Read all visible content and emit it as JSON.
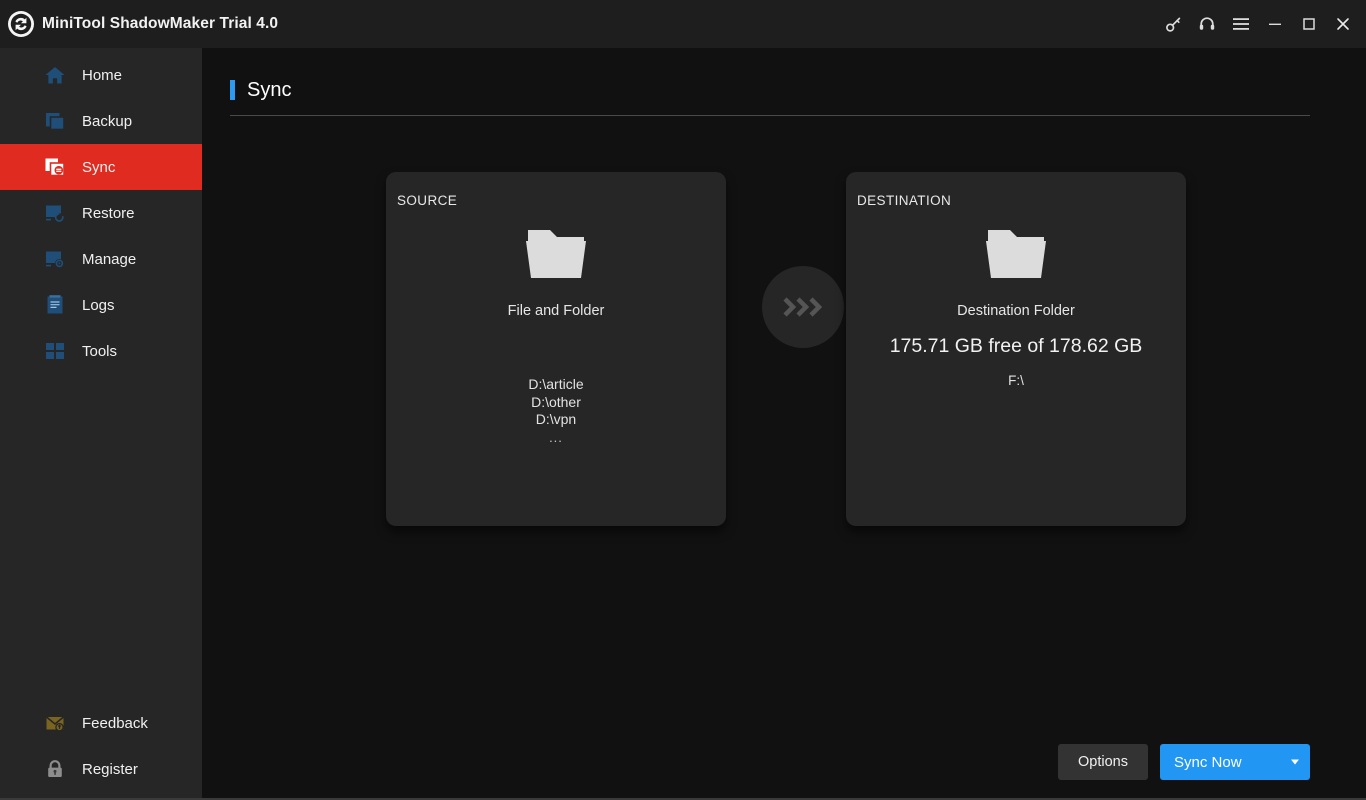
{
  "window": {
    "title": "MiniTool ShadowMaker Trial 4.0",
    "logo_icon": "sync-circle-logo-icon",
    "controls": [
      {
        "name": "key-icon",
        "label": "Key"
      },
      {
        "name": "headset-icon",
        "label": "Support"
      },
      {
        "name": "hamburger-icon",
        "label": "Menu"
      },
      {
        "name": "minimize-icon",
        "label": "Minimize"
      },
      {
        "name": "maximize-icon",
        "label": "Maximize"
      },
      {
        "name": "close-icon",
        "label": "Close"
      }
    ]
  },
  "sidebar": {
    "items": [
      {
        "label": "Home",
        "icon": "home-icon",
        "active": false
      },
      {
        "label": "Backup",
        "icon": "backup-icon",
        "active": false
      },
      {
        "label": "Sync",
        "icon": "sync-icon",
        "active": true
      },
      {
        "label": "Restore",
        "icon": "restore-icon",
        "active": false
      },
      {
        "label": "Manage",
        "icon": "manage-icon",
        "active": false
      },
      {
        "label": "Logs",
        "icon": "logs-icon",
        "active": false
      },
      {
        "label": "Tools",
        "icon": "tools-icon",
        "active": false
      }
    ],
    "bottom_items": [
      {
        "label": "Feedback",
        "icon": "feedback-envelope-icon"
      },
      {
        "label": "Register",
        "icon": "lock-icon"
      }
    ]
  },
  "page": {
    "title": "Sync"
  },
  "source": {
    "label": "SOURCE",
    "icon": "folder-icon",
    "kind": "File and Folder",
    "paths": [
      "D:\\article",
      "D:\\other",
      "D:\\vpn"
    ],
    "more": "..."
  },
  "transfer": {
    "icon": "triple-chevron-right-icon"
  },
  "destination": {
    "label": "DESTINATION",
    "icon": "folder-icon",
    "kind": "Destination Folder",
    "free_space": "175.71 GB free of 178.62 GB",
    "drive": "F:\\"
  },
  "footer": {
    "options_label": "Options",
    "sync_now_label": "Sync Now",
    "dropdown_icon": "caret-down-icon"
  },
  "colors": {
    "accent_red": "#e02b20",
    "accent_blue": "#2196f3",
    "title_accent": "#2f9bf0",
    "sidebar_bg": "#262626",
    "content_bg": "#111111",
    "titlebar_bg": "#1e1e1e",
    "icon_blue": "#1f4e79",
    "feedback_gold": "#7a6420"
  }
}
